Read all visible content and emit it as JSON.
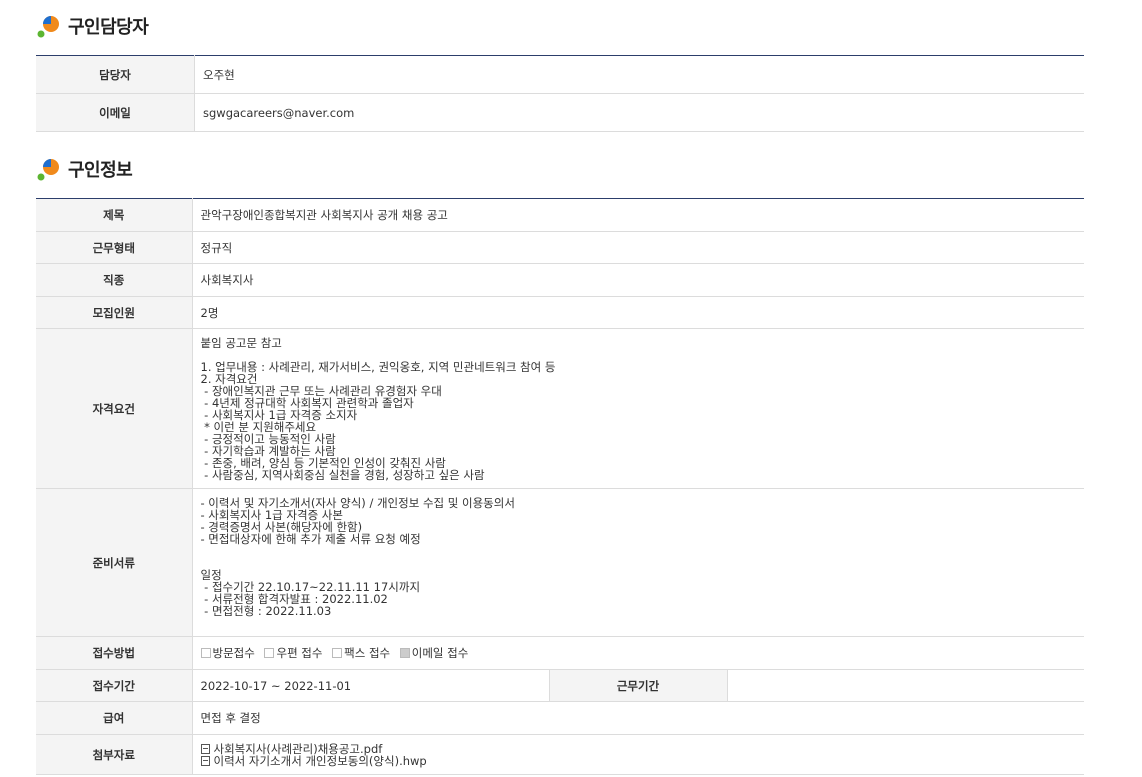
{
  "contact_section": {
    "title": "구인담당자",
    "rows": [
      {
        "label": "담당자",
        "value": "오주현"
      },
      {
        "label": "이메일",
        "value": "sgwgacareers@naver.com"
      }
    ]
  },
  "job_section": {
    "title": "구인정보",
    "subject": {
      "label": "제목",
      "value": "관악구장애인종합복지관 사회복지사 공개 채용 공고"
    },
    "employment_type": {
      "label": "근무형태",
      "value": "정규직"
    },
    "job_category": {
      "label": "직종",
      "value": "사회복지사"
    },
    "headcount": {
      "label": "모집인원",
      "value": "2명"
    },
    "requirements": {
      "label": "자격요건",
      "value": "붙임 공고문 참고\n\n1. 업무내용 : 사례관리, 재가서비스, 권익옹호, 지역 민관네트워크 참여 등\n2. 자격요건\n - 장애인복지관 근무 또는 사례관리 유경험자 우대\n - 4년제 정규대학 사회복지 관련학과 졸업자\n - 사회복지사 1급 자격증 소지자\n * 이런 분 지원해주세요\n - 긍정적이고 능동적인 사람\n - 자기학습과 계발하는 사람\n - 존중, 배려, 양심 등 기본적인 인성이 갖춰진 사람\n - 사람중심, 지역사회중심 실천을 경험, 성장하고 싶은 사람"
    },
    "documents": {
      "label": "준비서류",
      "value": "- 이력서 및 자기소개서(자사 양식) / 개인정보 수집 및 이용동의서\n- 사회복지사 1급 자격증 사본\n- 경력증명서 사본(해당자에 한함)\n- 면접대상자에 한해 추가 제출 서류 요청 예정\n\n\n일정\n - 접수기간 22.10.17~22.11.11 17시까지\n - 서류전형 합격자발표 : 2022.11.02\n - 면접전형 : 2022.11.03"
    },
    "application_method": {
      "label": "접수방법",
      "options": [
        {
          "label": "방문접수",
          "checked": false
        },
        {
          "label": "우편 접수",
          "checked": false
        },
        {
          "label": "팩스 접수",
          "checked": false
        },
        {
          "label": "이메일 접수",
          "checked": true
        }
      ]
    },
    "application_period": {
      "label": "접수기간",
      "value": "2022-10-17 ~ 2022-11-01"
    },
    "work_period": {
      "label": "근무기간",
      "value": ""
    },
    "salary": {
      "label": "급여",
      "value": "면접 후 결정"
    },
    "attachments": {
      "label": "첨부자료",
      "files": [
        "사회복지사(사례관리)채용공고.pdf",
        "이력서 자기소개서 개인정보동의(양식).hwp"
      ]
    }
  }
}
